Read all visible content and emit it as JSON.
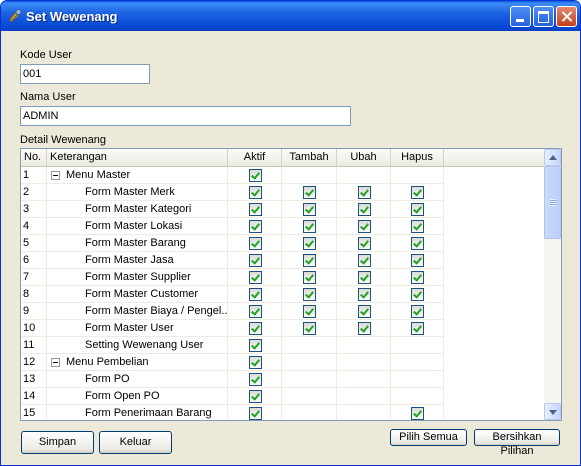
{
  "window": {
    "title": "Set Wewenang"
  },
  "form": {
    "kode_user_label": "Kode User",
    "kode_user_value": "001",
    "nama_user_label": "Nama User",
    "nama_user_value": "ADMIN",
    "detail_label": "Detail Wewenang"
  },
  "grid": {
    "columns": [
      "No.",
      "Keterangan",
      "Aktif",
      "Tambah",
      "Ubah",
      "Hapus"
    ],
    "rows": [
      {
        "no": "1",
        "keterangan": "Menu Master",
        "level": 0,
        "expander": true,
        "aktif": true,
        "tambah": false,
        "ubah": false,
        "hapus": false
      },
      {
        "no": "2",
        "keterangan": "Form Master Merk",
        "level": 1,
        "expander": false,
        "aktif": true,
        "tambah": true,
        "ubah": true,
        "hapus": true
      },
      {
        "no": "3",
        "keterangan": "Form Master Kategori",
        "level": 1,
        "expander": false,
        "aktif": true,
        "tambah": true,
        "ubah": true,
        "hapus": true
      },
      {
        "no": "4",
        "keterangan": "Form Master Lokasi",
        "level": 1,
        "expander": false,
        "aktif": true,
        "tambah": true,
        "ubah": true,
        "hapus": true
      },
      {
        "no": "5",
        "keterangan": "Form Master Barang",
        "level": 1,
        "expander": false,
        "aktif": true,
        "tambah": true,
        "ubah": true,
        "hapus": true
      },
      {
        "no": "6",
        "keterangan": "Form Master Jasa",
        "level": 1,
        "expander": false,
        "aktif": true,
        "tambah": true,
        "ubah": true,
        "hapus": true
      },
      {
        "no": "7",
        "keterangan": "Form Master Supplier",
        "level": 1,
        "expander": false,
        "aktif": true,
        "tambah": true,
        "ubah": true,
        "hapus": true
      },
      {
        "no": "8",
        "keterangan": "Form Master Customer",
        "level": 1,
        "expander": false,
        "aktif": true,
        "tambah": true,
        "ubah": true,
        "hapus": true
      },
      {
        "no": "9",
        "keterangan": "Form Master Biaya / Pengel...",
        "level": 1,
        "expander": false,
        "aktif": true,
        "tambah": true,
        "ubah": true,
        "hapus": true
      },
      {
        "no": "10",
        "keterangan": "Form Master User",
        "level": 1,
        "expander": false,
        "aktif": true,
        "tambah": true,
        "ubah": true,
        "hapus": true
      },
      {
        "no": "11",
        "keterangan": "Setting Wewenang User",
        "level": 1,
        "expander": false,
        "aktif": true,
        "tambah": false,
        "ubah": false,
        "hapus": false
      },
      {
        "no": "12",
        "keterangan": "Menu Pembelian",
        "level": 0,
        "expander": true,
        "aktif": true,
        "tambah": false,
        "ubah": false,
        "hapus": false
      },
      {
        "no": "13",
        "keterangan": "Form PO",
        "level": 1,
        "expander": false,
        "aktif": true,
        "tambah": false,
        "ubah": false,
        "hapus": false
      },
      {
        "no": "14",
        "keterangan": "Form Open PO",
        "level": 1,
        "expander": false,
        "aktif": true,
        "tambah": false,
        "ubah": false,
        "hapus": false
      },
      {
        "no": "15",
        "keterangan": "Form Penerimaan Barang",
        "level": 1,
        "expander": false,
        "aktif": true,
        "tambah": false,
        "ubah": false,
        "hapus": true
      }
    ]
  },
  "buttons": {
    "simpan": "Simpan",
    "keluar": "Keluar",
    "pilih_semua": "Pilih Semua",
    "bersihkan": "Bersihkan Pilihan"
  },
  "icons": {
    "window_icon": "tools-icon",
    "minimize": "minimize-icon",
    "maximize": "maximize-icon",
    "close": "close-icon"
  },
  "colors": {
    "titlebar": "#0a5ddc",
    "window_bg": "#ece9d8",
    "check": "#21a121"
  }
}
